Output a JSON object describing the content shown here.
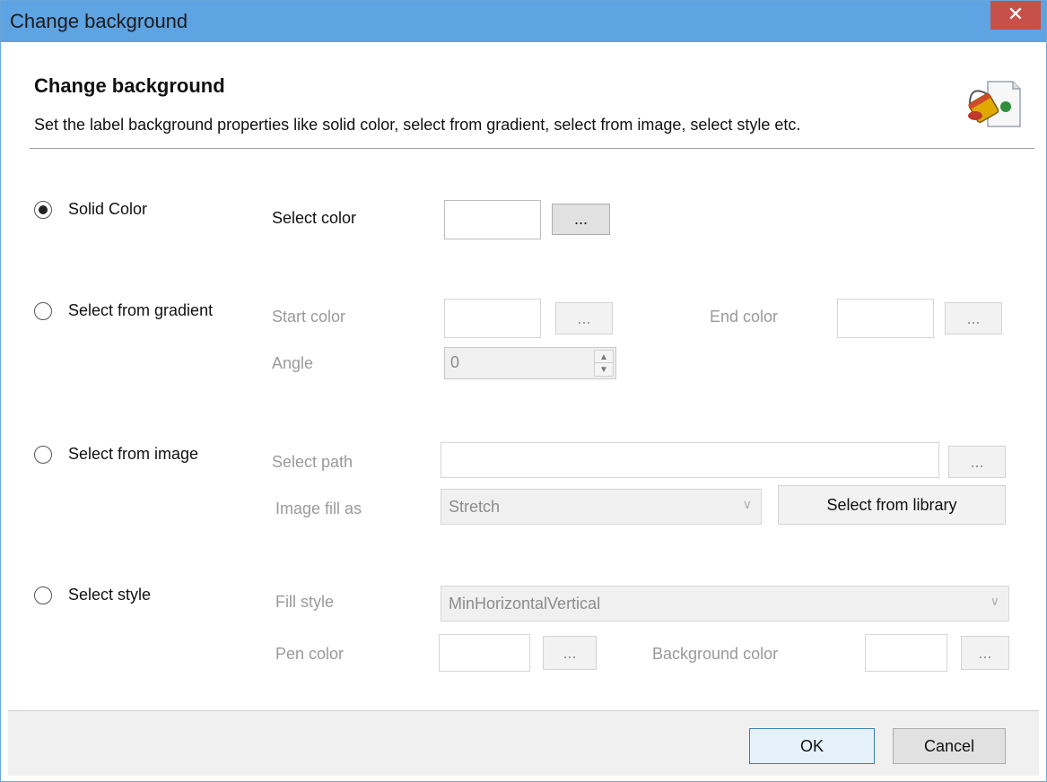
{
  "window": {
    "title": "Change background",
    "close_glyph": "✕"
  },
  "header": {
    "title": "Change background",
    "description": "Set the label background properties like solid color, select from gradient, select from image, select style etc.",
    "icon": "paint-bucket-icon"
  },
  "solid": {
    "radio_label": "Solid Color",
    "checked": true,
    "select_color_label": "Select color",
    "browse_label": "..."
  },
  "gradient": {
    "radio_label": "Select from gradient",
    "start_color_label": "Start color",
    "start_browse_label": "...",
    "end_color_label": "End color",
    "end_browse_label": "...",
    "angle_label": "Angle",
    "angle_value": "0"
  },
  "image": {
    "radio_label": "Select from image",
    "path_label": "Select path",
    "path_browse_label": "...",
    "fill_label": "Image fill as",
    "fill_value": "Stretch",
    "library_button": "Select from library"
  },
  "style": {
    "radio_label": "Select style",
    "fill_style_label": "Fill style",
    "fill_style_value": "MinHorizontalVertical",
    "pen_color_label": "Pen color",
    "pen_browse_label": "...",
    "bg_color_label": "Background color",
    "bg_browse_label": "..."
  },
  "footer": {
    "ok_label": "OK",
    "cancel_label": "Cancel"
  },
  "colors": {
    "titlebar": "#5ea3e2",
    "close": "#c7504a",
    "disabled_text": "#9a9a9a"
  }
}
